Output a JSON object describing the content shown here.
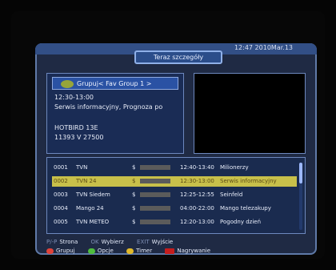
{
  "header": {
    "clock": "12:47 2010Mar.13",
    "title": "Teraz szczegóły"
  },
  "info": {
    "group": "Grupuj< Fav Group 1 >",
    "time": "12:30-13:00",
    "desc": "Serwis informacyjny, Prognoza po",
    "sat": "HOTBIRD 13E",
    "freq": "11393 V 27500"
  },
  "channels": [
    {
      "num": "0001",
      "name": "TVN",
      "dollar": "$",
      "progress": 0.12,
      "time": "12:40-13:40",
      "event": "Milionerzy"
    },
    {
      "num": "0002",
      "name": "TVN 24",
      "dollar": "$",
      "progress": 0.58,
      "time": "12:30-13:00",
      "event": "Serwis informacyjny"
    },
    {
      "num": "0003",
      "name": "TVN Siedem",
      "dollar": "$",
      "progress": 0.55,
      "time": "12:25-12:55",
      "event": "Seinfeld"
    },
    {
      "num": "0004",
      "name": "Mango 24",
      "dollar": "$",
      "progress": 0.68,
      "time": "04:00-22:00",
      "event": "Mango telezakupy"
    },
    {
      "num": "0005",
      "name": "TVN METEO",
      "dollar": "$",
      "progress": 0.62,
      "time": "12:20-13:00",
      "event": "Pogodny dzień"
    }
  ],
  "footer": {
    "page_key": "P/-P",
    "page_label": "Strona",
    "select_key": "OK",
    "select_label": "Wybierz",
    "exit_key": "EXIT",
    "exit_label": "Wyjście",
    "red_label": "Grupuj",
    "green_label": "Opcje",
    "yellow_label": "Timer",
    "rec_label": "Nagrywanie"
  },
  "colors": {
    "red": "#e0433a",
    "green": "#4fbd3e",
    "yellow": "#e1b92a",
    "rec": "#c51d1d",
    "selected_row": "#c8c04a",
    "progress": "#e0a11a"
  }
}
